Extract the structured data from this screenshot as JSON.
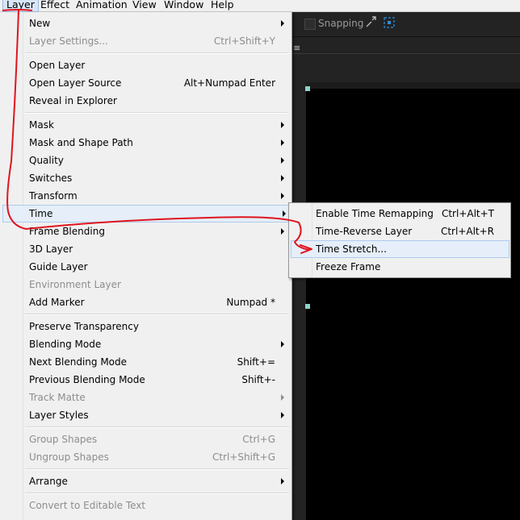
{
  "menubar": {
    "items": [
      {
        "label": "Layer"
      },
      {
        "label": "Effect"
      },
      {
        "label": "Animation"
      },
      {
        "label": "View"
      },
      {
        "label": "Window"
      },
      {
        "label": "Help"
      }
    ]
  },
  "toolbar": {
    "snapping_label": "Snapping",
    "icons": [
      "snap-expand-icon",
      "snap-target-icon"
    ],
    "panel_menu_icon": "hamburger-icon"
  },
  "layer_menu": {
    "items": [
      {
        "label": "New",
        "submenu": true
      },
      {
        "label": "Layer Settings...",
        "shortcut": "Ctrl+Shift+Y",
        "disabled": true
      },
      {
        "label": "Open Layer"
      },
      {
        "label": "Open Layer Source",
        "shortcut": "Alt+Numpad Enter"
      },
      {
        "label": "Reveal in Explorer"
      },
      {
        "label": "Mask",
        "submenu": true
      },
      {
        "label": "Mask and Shape Path",
        "submenu": true
      },
      {
        "label": "Quality",
        "submenu": true
      },
      {
        "label": "Switches",
        "submenu": true
      },
      {
        "label": "Transform",
        "submenu": true
      },
      {
        "label": "Time",
        "submenu": true,
        "highlighted": true
      },
      {
        "label": "Frame Blending",
        "submenu": true
      },
      {
        "label": "3D Layer"
      },
      {
        "label": "Guide Layer"
      },
      {
        "label": "Environment Layer",
        "disabled": true
      },
      {
        "label": "Add Marker",
        "shortcut": "Numpad *"
      },
      {
        "label": "Preserve Transparency"
      },
      {
        "label": "Blending Mode",
        "submenu": true
      },
      {
        "label": "Next Blending Mode",
        "shortcut": "Shift+="
      },
      {
        "label": "Previous Blending Mode",
        "shortcut": "Shift+-"
      },
      {
        "label": "Track Matte",
        "submenu": true,
        "disabled": true
      },
      {
        "label": "Layer Styles",
        "submenu": true
      },
      {
        "label": "Group Shapes",
        "shortcut": "Ctrl+G",
        "disabled": true
      },
      {
        "label": "Ungroup Shapes",
        "shortcut": "Ctrl+Shift+G",
        "disabled": true
      },
      {
        "label": "Arrange",
        "submenu": true
      },
      {
        "label": "Convert to Editable Text",
        "disabled": true
      }
    ]
  },
  "time_submenu": {
    "items": [
      {
        "label": "Enable Time Remapping",
        "shortcut": "Ctrl+Alt+T"
      },
      {
        "label": "Time-Reverse Layer",
        "shortcut": "Ctrl+Alt+R"
      },
      {
        "label": "Time Stretch...",
        "highlighted": true
      },
      {
        "label": "Freeze Frame"
      }
    ]
  },
  "colors": {
    "menu_bg": "#f0f0f0",
    "highlight_bg": "#e5eef9",
    "highlight_border": "#aecbef",
    "disabled_text": "#8d8d8d",
    "annotation_red": "#e0141e",
    "canvas_bg": "#000000"
  }
}
